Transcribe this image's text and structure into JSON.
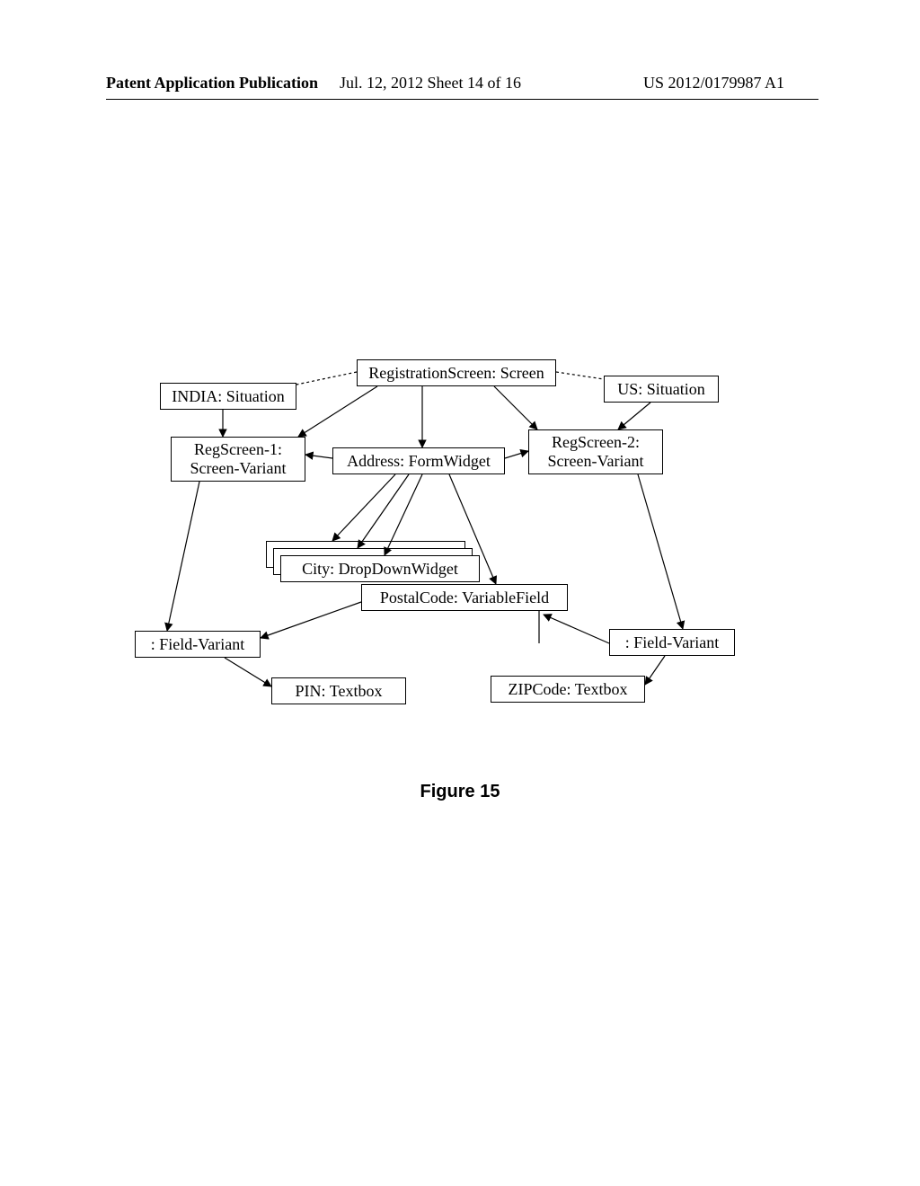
{
  "header": {
    "left": "Patent Application Publication",
    "center": "Jul. 12, 2012   Sheet 14 of 16",
    "right": "US 2012/0179987 A1"
  },
  "figure_caption": "Figure 15",
  "nodes": {
    "reg_screen": "RegistrationScreen: Screen",
    "india": "INDIA: Situation",
    "us": "US: Situation",
    "reg1": "RegScreen-1:\nScreen-Variant",
    "address": "Address: FormWidget",
    "reg2": "RegScreen-2:\nScreen-Variant",
    "city": "City: DropDownWidget",
    "postal": "PostalCode: VariableField",
    "fv_left": ": Field-Variant",
    "fv_right": ": Field-Variant",
    "pin": "PIN: Textbox",
    "zip": "ZIPCode: Textbox"
  }
}
